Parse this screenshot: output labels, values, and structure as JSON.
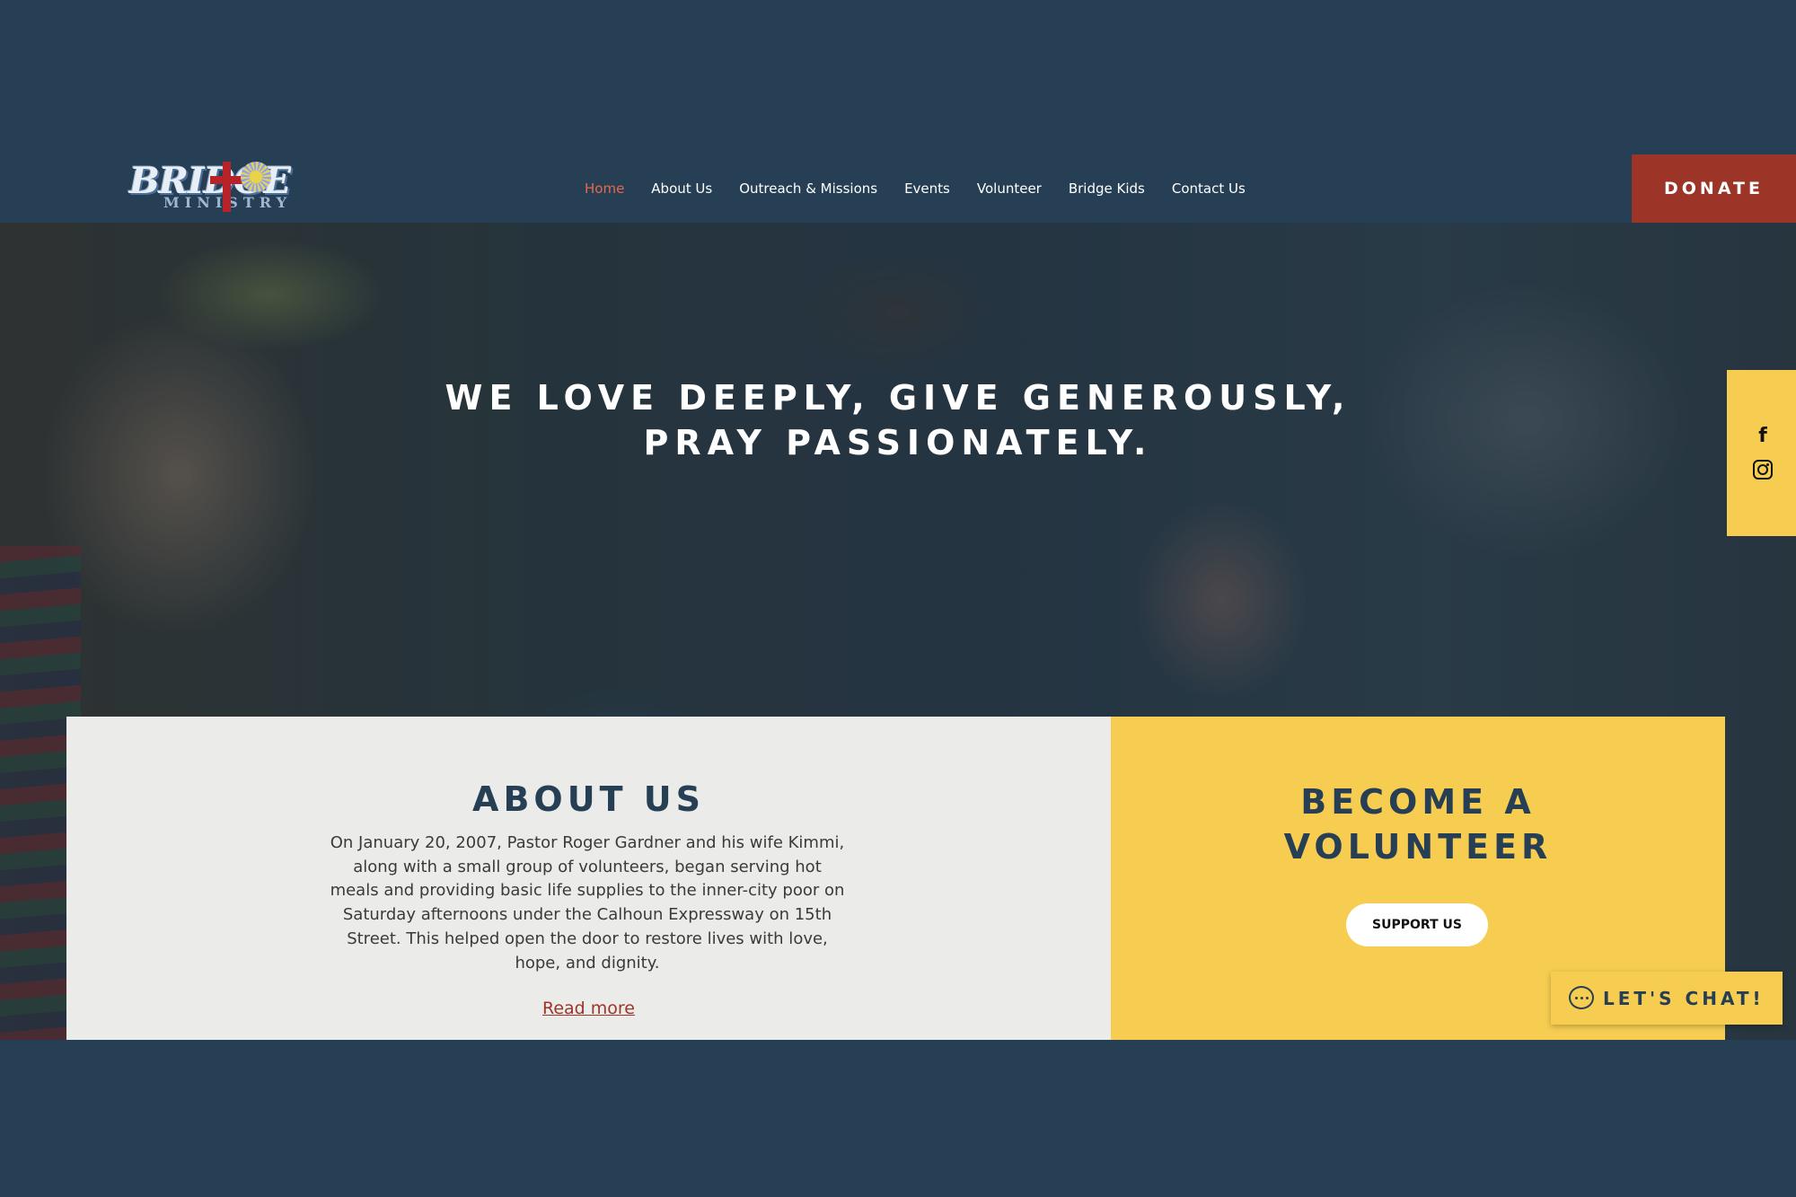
{
  "header": {
    "logo_word": "BRIDGE",
    "logo_sub": "MINISTRY",
    "nav": [
      {
        "label": "Home",
        "active": true
      },
      {
        "label": "About Us"
      },
      {
        "label": "Outreach & Missions"
      },
      {
        "label": "Events"
      },
      {
        "label": "Volunteer"
      },
      {
        "label": "Bridge Kids"
      },
      {
        "label": "Contact Us"
      }
    ],
    "donate_label": "DONATE"
  },
  "hero": {
    "headline_line1": "WE LOVE DEEPLY, GIVE GENEROUSLY,",
    "headline_line2": "PRAY PASSIONATELY."
  },
  "social": {
    "facebook_glyph": "f",
    "icons": [
      "facebook-icon",
      "instagram-icon"
    ]
  },
  "about": {
    "title": "ABOUT US",
    "body": "On January 20, 2007, Pastor Roger Gardner and his wife Kimmi, along with a small group of volunteers, began serving hot meals and providing basic life supplies to the inner-city poor on Saturday afternoons under the Calhoun Expressway on 15th Street. This helped open the door to restore lives with love, hope, and dignity.",
    "link": "Read more"
  },
  "volunteer": {
    "title_line1": "BECOME A",
    "title_line2": "VOLUNTEER",
    "button": "SUPPORT US"
  },
  "chat": {
    "label": "LET'S CHAT!"
  },
  "colors": {
    "navy": "#263f55",
    "accent_red": "#9c3528",
    "nav_active": "#e56a4c",
    "yellow": "#f6cd50",
    "panel_gray": "#ebebe9"
  }
}
